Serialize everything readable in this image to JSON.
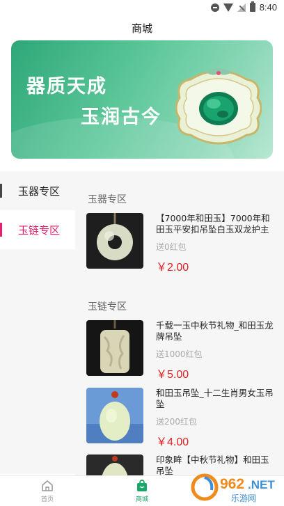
{
  "status_bar": {
    "time": "8:40"
  },
  "header": {
    "title": "商城"
  },
  "banner": {
    "line1": "器质天成",
    "line2": "玉润古今"
  },
  "sidebar": {
    "items": [
      {
        "label": "玉器专区",
        "active": false
      },
      {
        "label": "玉链专区",
        "active": true
      }
    ]
  },
  "sections": [
    {
      "title": "玉器专区",
      "products": [
        {
          "name": "【7000年和田玉】7000年和田玉平安扣吊坠白玉双龙护主",
          "bonus": "送0红包",
          "price": "￥2.00"
        }
      ]
    },
    {
      "title": "玉链专区",
      "products": [
        {
          "name": "千载一玉中秋节礼物_和田玉龙牌吊坠",
          "bonus": "送1000红包",
          "price": "￥5.00"
        },
        {
          "name": "和田玉吊坠_十二生肖男女玉吊坠",
          "bonus": "送200红包",
          "price": "￥4.00"
        },
        {
          "name": "印象眸【中秋节礼物】和田玉吊坠",
          "bonus": "",
          "price": ""
        }
      ]
    }
  ],
  "bottom_nav": {
    "items": [
      {
        "label": "首页",
        "icon": "home-icon",
        "active": false
      },
      {
        "label": "商城",
        "icon": "bag-icon",
        "active": true
      }
    ]
  },
  "watermark": {
    "brand": "962.NET",
    "subtitle": "乐游网"
  },
  "colors": {
    "accent": "#e51f6a",
    "price": "#e02020",
    "nav_active": "#18a867",
    "banner": "#3fb583"
  }
}
